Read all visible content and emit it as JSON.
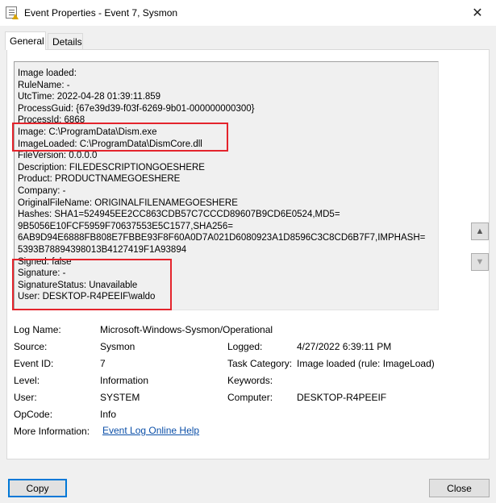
{
  "window": {
    "title": "Event Properties - Event 7, Sysmon",
    "close_glyph": "✕"
  },
  "tabs": [
    {
      "label": "General"
    },
    {
      "label": "Details"
    }
  ],
  "event_text": {
    "lines": [
      "Image loaded:",
      "RuleName: -",
      "UtcTime: 2022-04-28 01:39:11.859",
      "ProcessGuid: {67e39d39-f03f-6269-9b01-000000000300}",
      "ProcessId: 6868",
      "Image: C:\\ProgramData\\Dism.exe",
      "ImageLoaded: C:\\ProgramData\\DismCore.dll",
      "FileVersion: 0.0.0.0",
      "Description: FILEDESCRIPTIONGOESHERE",
      "Product: PRODUCTNAMEGOESHERE",
      "Company: -",
      "OriginalFileName: ORIGINALFILENAMEGOESHERE",
      "Hashes: SHA1=524945EE2CC863CDB57C7CCCD89607B9CD6E0524,MD5=",
      "9B5056E10FCF5959F70637553E5C1577,SHA256=",
      "6AB9D94E6888FB808E7FBBE93F8F60A0D7A021D6080923A1D8596C3C8CD6B7F7,IMPHASH=",
      "5393B78894398013B4127419F1A93894",
      "Signed: false",
      "Signature: -",
      "SignatureStatus: Unavailable",
      "User: DESKTOP-R4PEEIF\\waldo"
    ],
    "highlight_color": "#e4242c"
  },
  "info": {
    "log_name": {
      "label": "Log Name:",
      "value": "Microsoft-Windows-Sysmon/Operational"
    },
    "source": {
      "label": "Source:",
      "value": "Sysmon"
    },
    "logged": {
      "label": "Logged:",
      "value": "4/27/2022 6:39:11 PM"
    },
    "event_id": {
      "label": "Event ID:",
      "value": "7"
    },
    "task_category": {
      "label": "Task Category:",
      "value": "Image loaded (rule: ImageLoad)"
    },
    "level": {
      "label": "Level:",
      "value": "Information"
    },
    "keywords": {
      "label": "Keywords:",
      "value": ""
    },
    "user": {
      "label": "User:",
      "value": "SYSTEM"
    },
    "computer": {
      "label": "Computer:",
      "value": "DESKTOP-R4PEEIF"
    },
    "opcode": {
      "label": "OpCode:",
      "value": "Info"
    },
    "more_info": {
      "label": "More Information:",
      "link": "Event Log Online Help"
    }
  },
  "buttons": {
    "copy": "Copy",
    "close": "Close",
    "up_arrow_icon": "▲",
    "down_arrow_icon": "▼"
  },
  "accent_colors": {
    "focus": "#0078d7",
    "link": "#0b4fa8"
  }
}
